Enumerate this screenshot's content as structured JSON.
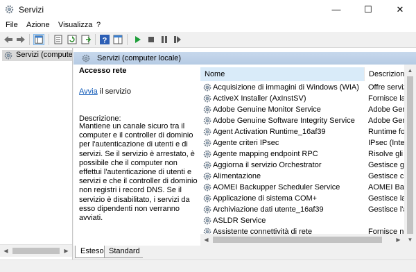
{
  "window": {
    "title": "Servizi",
    "minimize_glyph": "—",
    "maximize_glyph": "☐",
    "close_glyph": "✕"
  },
  "menu": [
    "File",
    "Azione",
    "Visualizza",
    "?"
  ],
  "toolbar": {
    "icons": [
      "back-icon",
      "forward-icon",
      "console-tree-icon",
      "properties-icon",
      "refresh-icon",
      "export-icon",
      "help-icon",
      "show-pane-icon",
      "start-icon",
      "stop-icon",
      "pause-icon",
      "restart-icon"
    ]
  },
  "tree": {
    "selected_item": "Servizi (computer locale)"
  },
  "panel": {
    "title": "Servizi (computer locale)",
    "selected_service": "Accesso rete",
    "action_link": "Avvia",
    "action_suffix": " il servizio",
    "description_label": "Descrizione:",
    "description_text": "Mantiene un canale sicuro tra il computer e il controller di dominio per l'autenticazione di utenti e di servizi. Se il servizio è arrestato, è possibile che il computer non effettui l'autenticazione di utenti e servizi e che il controller di dominio non registri i record DNS. Se il servizio è disabilitato, i servizi da esso dipendenti non verranno avviati."
  },
  "columns": {
    "name": "Nome",
    "description": "Descrizione"
  },
  "services": [
    {
      "name": "Acquisizione di immagini di Windows (WIA)",
      "description": "Offre servizi"
    },
    {
      "name": "ActiveX Installer (AxInstSV)",
      "description": "Fornisce la c"
    },
    {
      "name": "Adobe Genuine Monitor Service",
      "description": "Adobe Genu"
    },
    {
      "name": "Adobe Genuine Software Integrity Service",
      "description": "Adobe Genu"
    },
    {
      "name": "Agent Activation Runtime_16af39",
      "description": "Runtime for"
    },
    {
      "name": "Agente criteri IPsec",
      "description": "IPsec (Intern"
    },
    {
      "name": "Agente mapping endpoint RPC",
      "description": "Risolve gli i"
    },
    {
      "name": "Aggiorna il servizio Orchestrator",
      "description": "Gestisce gli"
    },
    {
      "name": "Alimentazione",
      "description": "Gestisce crit"
    },
    {
      "name": "AOMEI Backupper Scheduler Service",
      "description": "AOMEI Back"
    },
    {
      "name": "Applicazione di sistema COM+",
      "description": "Gestisce la c"
    },
    {
      "name": "Archiviazione dati utente_16af39",
      "description": "Gestisce l'ar"
    },
    {
      "name": "ASLDR Service",
      "description": ""
    },
    {
      "name": "Assistente connettività di rete",
      "description": "Fornisce no"
    }
  ],
  "tabs": [
    "Esteso",
    "Standard"
  ],
  "colors": {
    "banner": "#c0d4ea",
    "selected_header": "#d9ebf9",
    "link": "#0b56b6",
    "start_icon": "#1e9e3a"
  }
}
